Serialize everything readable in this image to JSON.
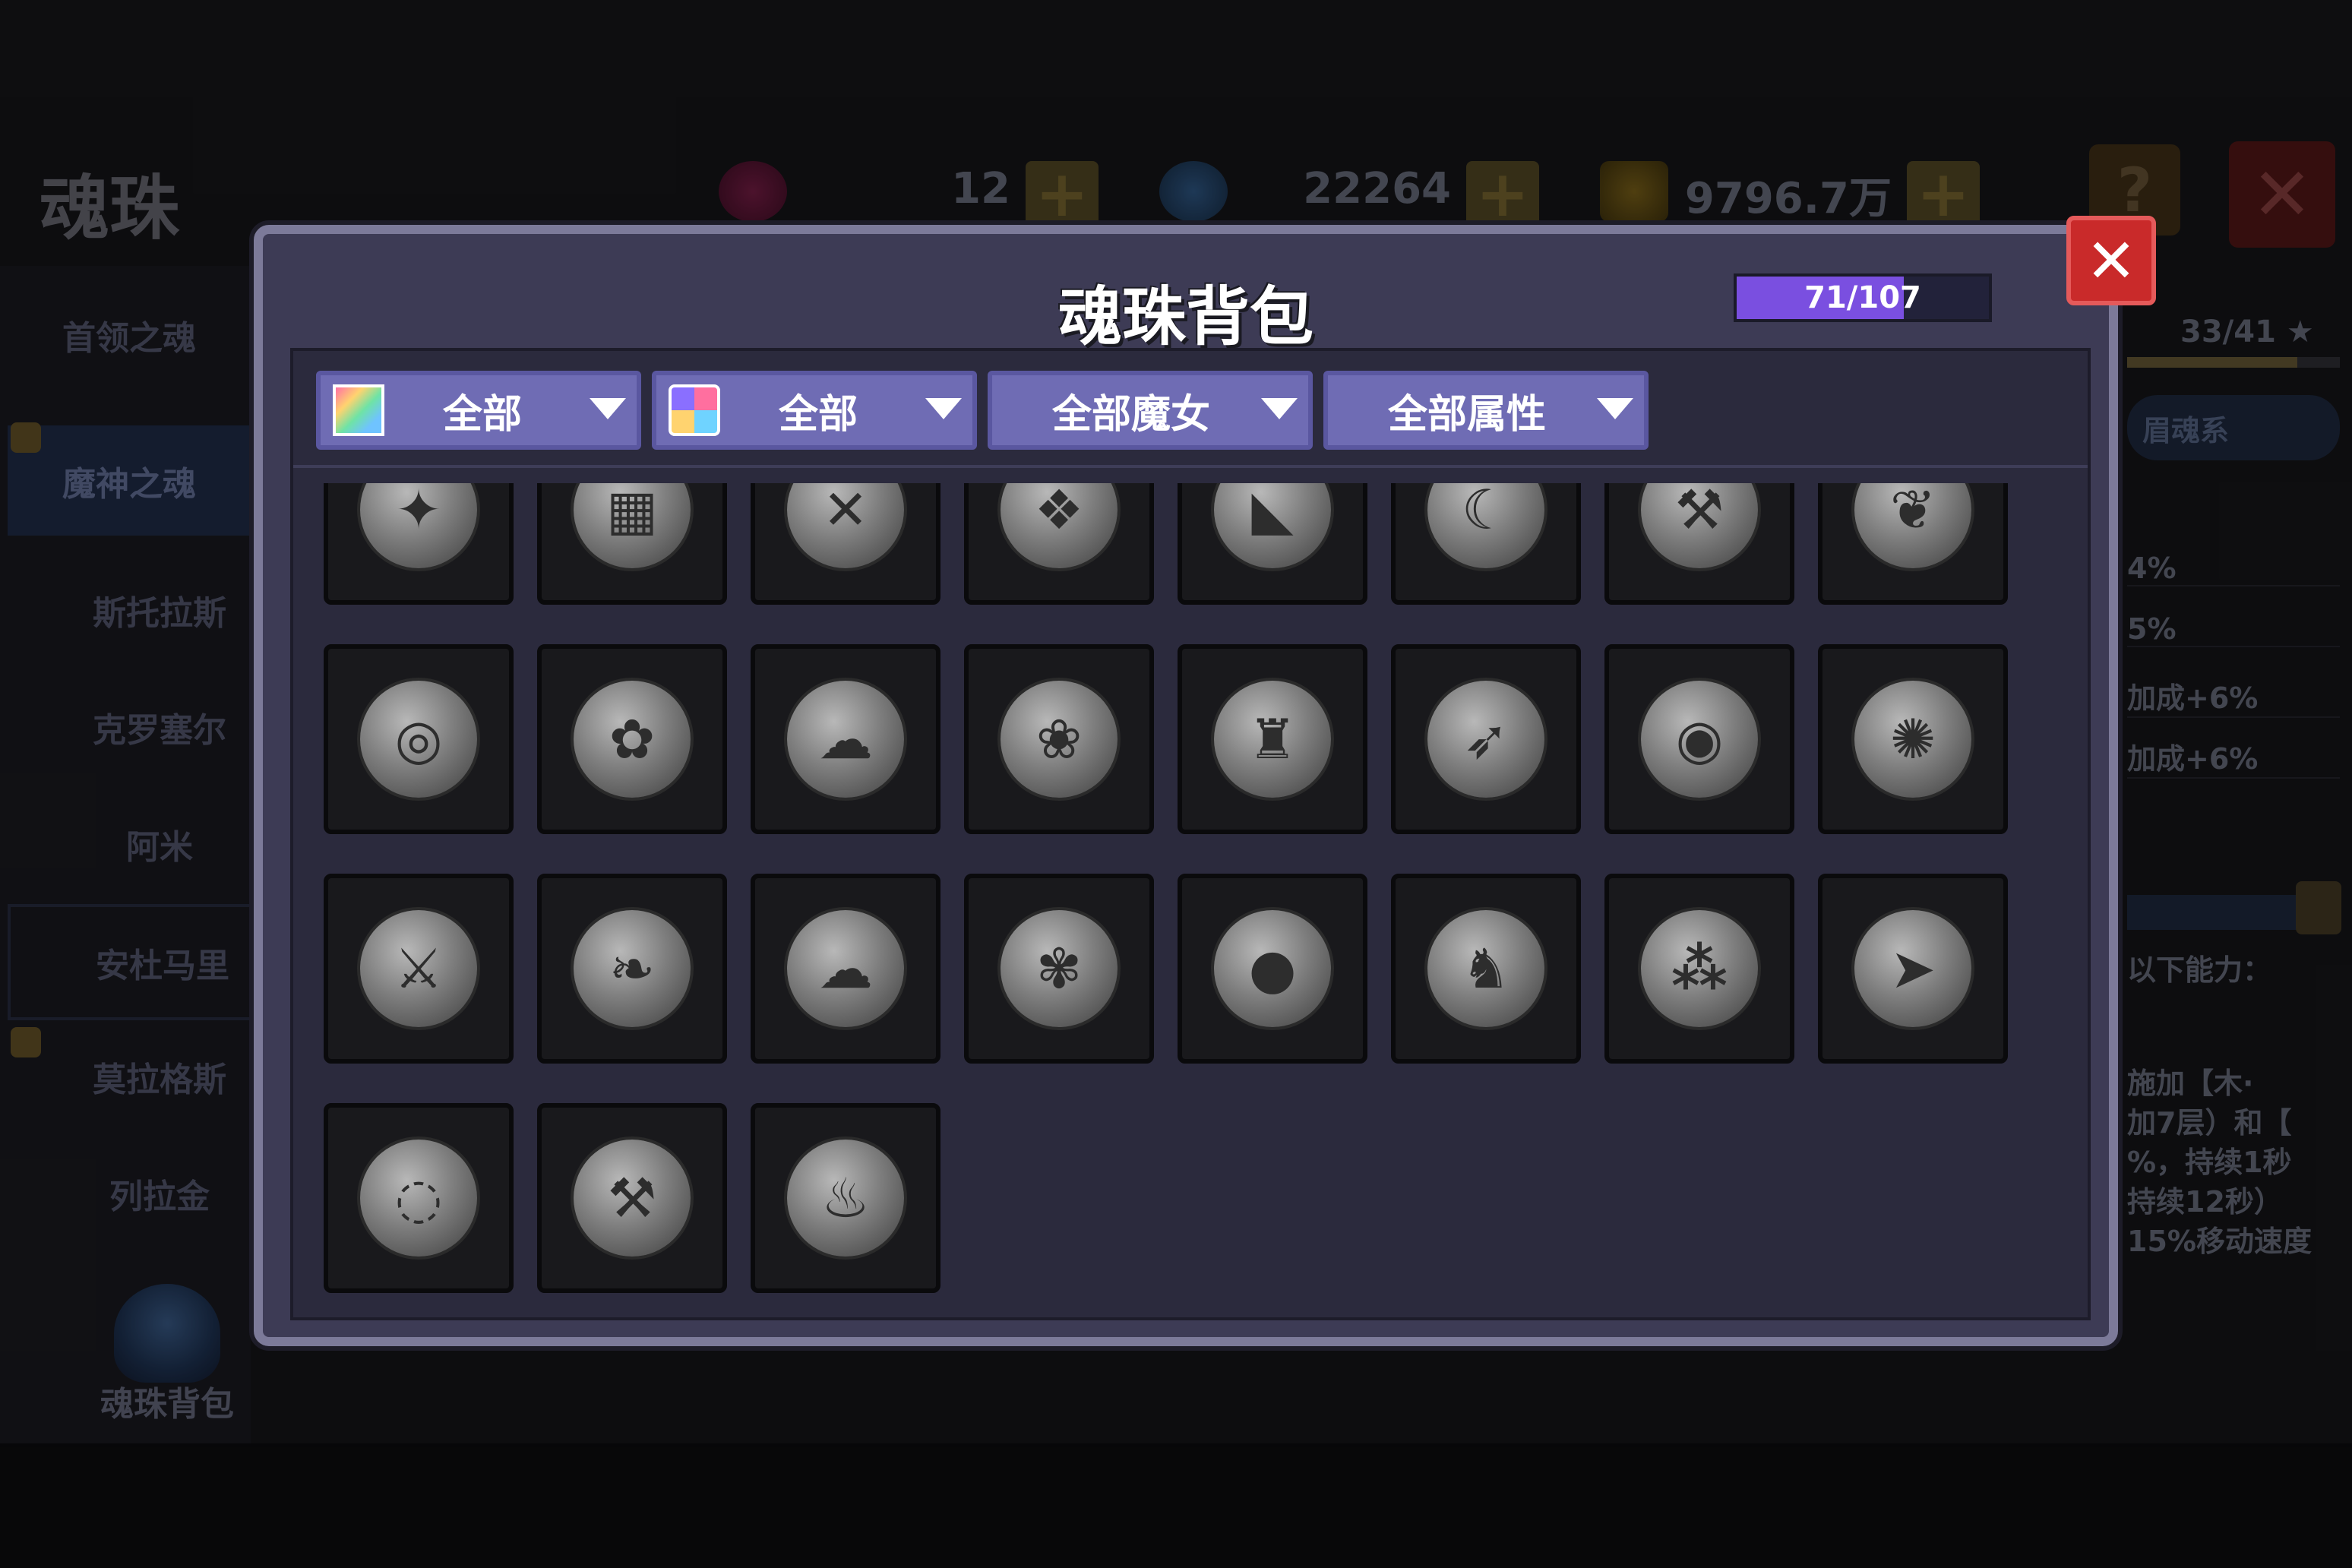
{
  "page": {
    "title": "魂珠"
  },
  "resources": [
    {
      "name": "gem-icon",
      "value": "12",
      "color": "#a0205a"
    },
    {
      "name": "crystal-icon",
      "value": "22264",
      "color": "#3a6fa6"
    },
    {
      "name": "coin-icon",
      "value": "9796.7万",
      "color": "#b08a20"
    }
  ],
  "sidebar": {
    "items": [
      {
        "label": "首领之魂"
      },
      {
        "label": "魔神之魂"
      },
      {
        "label": "斯托拉斯"
      },
      {
        "label": "克罗塞尔"
      },
      {
        "label": "阿米"
      },
      {
        "label": "安杜马里"
      },
      {
        "label": "莫拉格斯"
      },
      {
        "label": "列拉金"
      }
    ],
    "bag_button": "魂珠背包"
  },
  "right_panel": {
    "progress": "33/41",
    "tab": "眉魂系",
    "lines": [
      "4%",
      "5%",
      "加成+6%",
      "加成+6%"
    ],
    "ability_title": "以下能力：",
    "desc": [
      "施加【木·",
      "加7层）和【",
      "%，持续1秒",
      "持续12秒）",
      "15%移动速度"
    ]
  },
  "modal": {
    "title": "魂珠背包",
    "capacity": {
      "current": 71,
      "max": 107,
      "label": "71/107"
    },
    "close": "✕",
    "filters": [
      {
        "label": "全部",
        "icon": "rainbow-icon"
      },
      {
        "label": "全部",
        "icon": "colors-grid-icon"
      },
      {
        "label": "全部魔女"
      },
      {
        "label": "全部属性"
      }
    ],
    "orbs": [
      "dragon-orb",
      "gate-orb",
      "crossed-swords-orb",
      "beast-orb",
      "claw-orb",
      "crescent-orb",
      "axe-orb",
      "wing-orb",
      "cannon-orb",
      "flower-orb",
      "ghost-orb",
      "bird-orb",
      "chalice-orb",
      "spear-orb",
      "ring-orb",
      "wolf-orb",
      "winged-sword-orb",
      "leaf-orb",
      "cloud-orb",
      "rose-orb",
      "capsule-orb",
      "knight-orb",
      "cells-orb",
      "arrow-orb",
      "swirl-orb",
      "double-axe-orb",
      "torch-orb"
    ]
  }
}
